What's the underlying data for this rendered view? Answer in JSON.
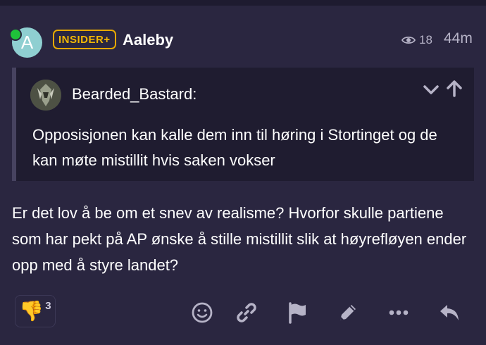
{
  "post": {
    "author": {
      "avatar_letter": "A",
      "flair": "INSIDER+",
      "username": "Aaleby"
    },
    "views": "18",
    "time": "44m",
    "quote": {
      "author": "Bearded_Bastard:",
      "text": "Opposisjonen kan kalle dem inn til høring i Stortinget og de kan møte mistillit hvis saken vokser"
    },
    "body": "Er det lov å be om et snev av realisme? Hvorfor skulle partiene som har pekt på AP ønske å stille mistillit slik at høyrefløyen ender opp med å styre landet?",
    "reaction": {
      "emoji": "👎",
      "count": "3"
    },
    "actions": [
      "smiley-icon",
      "link-icon",
      "flag-icon",
      "pencil-icon",
      "ellipsis-icon",
      "reply-icon"
    ],
    "colors": {
      "background": "#2a2640",
      "quote_background": "#1f1c30",
      "flair": "#f2b705",
      "online": "#1fc13a",
      "muted": "#b6b3c7"
    }
  }
}
